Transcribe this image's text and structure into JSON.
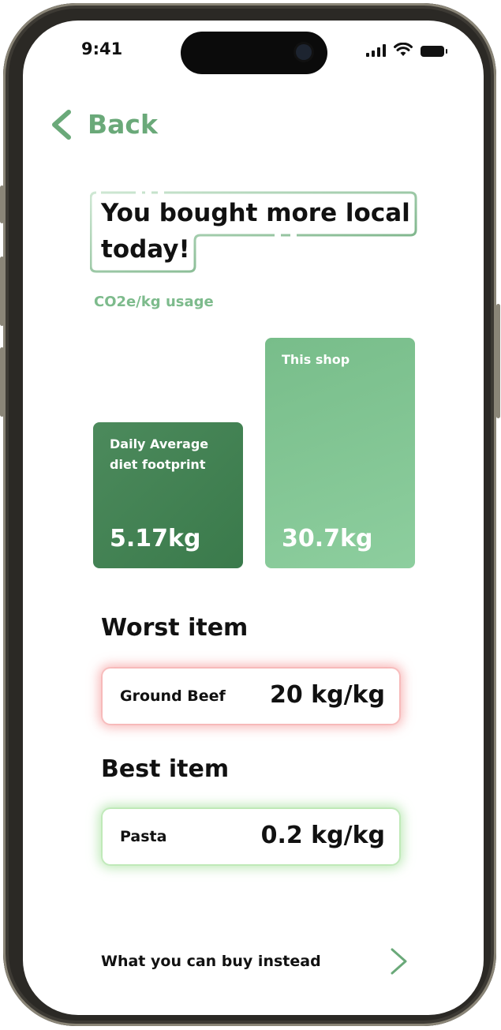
{
  "status_bar": {
    "time": "9:41"
  },
  "nav": {
    "back_label": "Back"
  },
  "headline": "You bought more local today!",
  "subtitle": "CO2e/kg usage",
  "cards": {
    "daily": {
      "label": "Daily Average diet footprint",
      "value": "5.17kg"
    },
    "shop": {
      "label": "This shop",
      "value": "30.7kg"
    }
  },
  "worst": {
    "heading": "Worst item",
    "name": "Ground Beef",
    "value": "20 kg/kg"
  },
  "best": {
    "heading": "Best item",
    "name": "Pasta",
    "value": "0.2 kg/kg"
  },
  "footer": {
    "label": "What you can buy instead"
  },
  "icons": {
    "back": "chevron-left-icon",
    "signal": "signal-icon",
    "wifi": "wifi-icon",
    "battery": "battery-icon",
    "arrow": "arrow-right-icon"
  },
  "colors": {
    "accent": "#6aa979",
    "card_dark": "#3f7e50",
    "card_light": "#84c595",
    "worst_glow": "#f28282",
    "best_glow": "#96dc8c"
  }
}
